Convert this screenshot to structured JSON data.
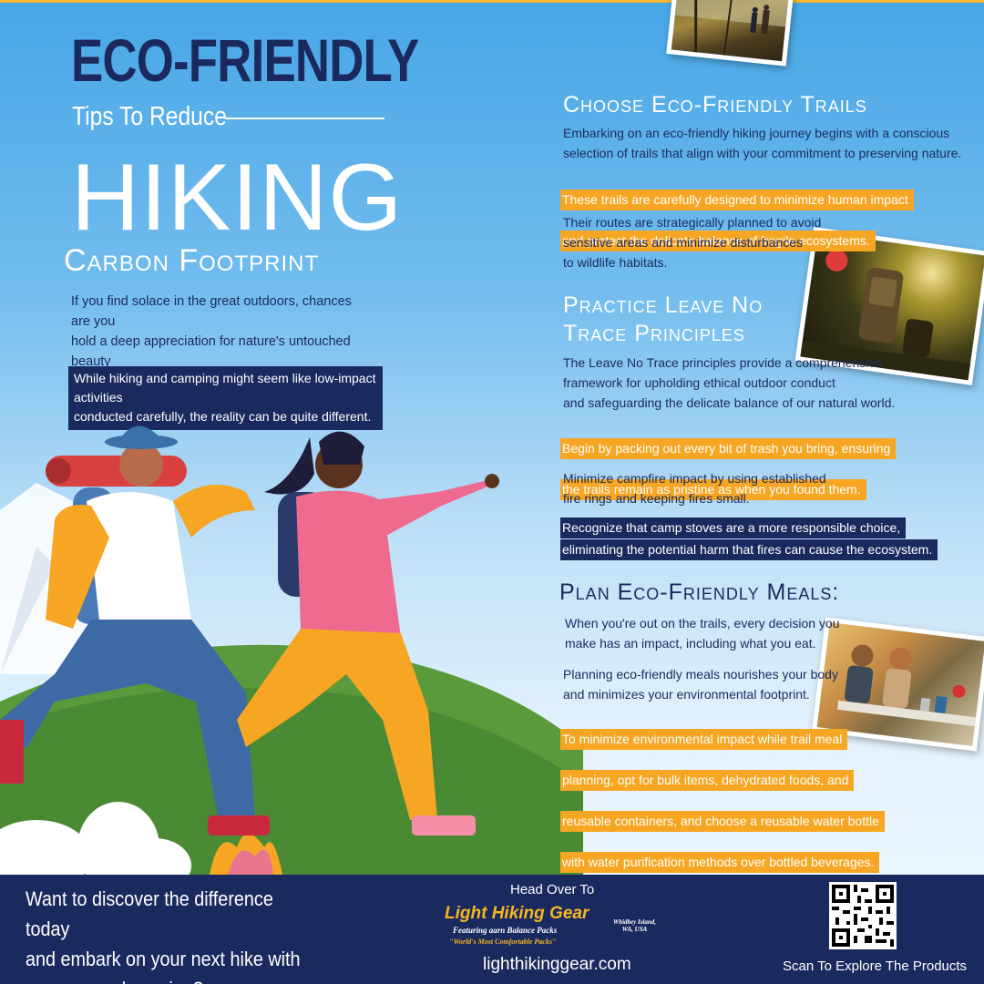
{
  "header": {
    "eco_title": "ECO-FRIENDLY",
    "tips": "Tips To Reduce",
    "hiking": "HIKING",
    "carbon": "Carbon Footprint"
  },
  "intro": {
    "paragraph": "If you find solace in the great outdoors, chances are you\nhold a deep appreciation for nature's untouched beauty\nand wish to safeguard it from the perils of climate change.",
    "highlight": "While hiking and camping might seem like low-impact activities\nconducted carefully, the reality can be quite different."
  },
  "section_trails": {
    "heading": "Choose Eco-Friendly Trails",
    "p1": "Embarking on an eco-friendly hiking journey begins with a conscious\nselection of trails that align with your commitment to preserving nature.",
    "hl_line1": "These trails are carefully designed to minimize human impact",
    "hl_line2": "and protect the delicate balance of fragile ecosystems.",
    "p2": "Their routes are strategically planned to avoid\nsensitive areas and minimize disturbances\nto wildlife habitats."
  },
  "section_lnt": {
    "heading_line1": "Practice Leave No",
    "heading_line2": "Trace Principles",
    "p1": "The Leave No Trace principles provide a comprehensive\nframework for upholding ethical outdoor conduct\nand safeguarding the delicate balance of our natural world.",
    "hl_line1": "Begin by packing out every bit of trash you bring, ensuring",
    "hl_line2": "the trails remain as pristine as when you found them.",
    "p2": "Minimize campfire impact by using established\nfire rings and keeping fires small.",
    "navy_line1": "Recognize that camp stoves are a more responsible choice,",
    "navy_line2": "eliminating the potential harm that fires can cause the ecosystem."
  },
  "section_meals": {
    "heading": "Plan Eco-Friendly Meals:",
    "p1": "When you're out on the trails, every decision you\nmake has an impact, including what you eat.",
    "p2": "Planning eco-friendly meals nourishes your body\nand minimizes your environmental footprint.",
    "hl_line1": "To minimize environmental impact while trail meal",
    "hl_line2": "planning, opt for bulk items, dehydrated foods, and",
    "hl_line3": "reusable containers, and choose a reusable water bottle",
    "hl_line4": "with water purification methods over bottled beverages."
  },
  "footer": {
    "cta": "Want to discover the difference today\nand embark on your next hike with\npurpose and passion?",
    "head_over": "Head Over To",
    "logo_main": "Light Hiking Gear",
    "logo_sub": "Featuring aarn Balance Packs",
    "logo_quote": "\"World's Most Comfortable Packs\"",
    "logo_location": "Whidbey Island,\nWA, USA",
    "url": "lighthikinggear.com",
    "scan": "Scan To Explore The Products"
  },
  "colors": {
    "navy": "#1b2a5e",
    "orange": "#f6a623",
    "sky": "#47a6e6"
  }
}
